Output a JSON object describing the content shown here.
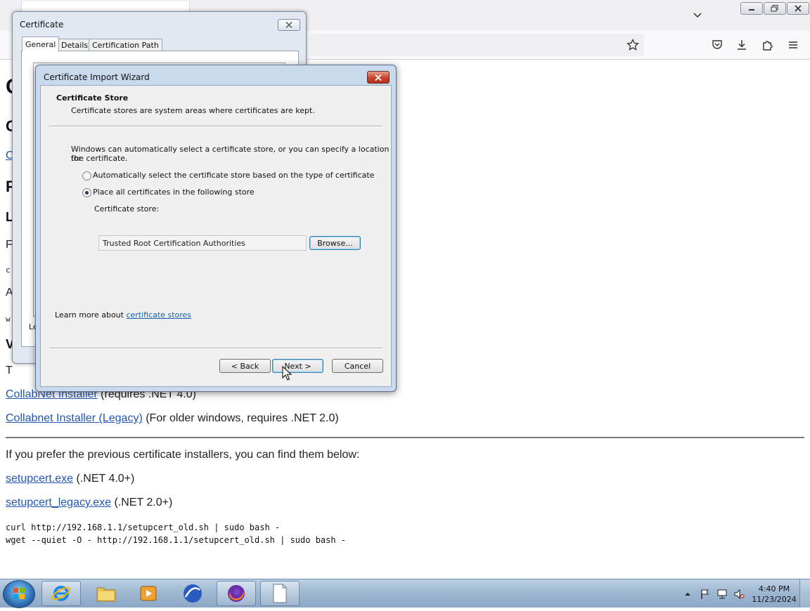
{
  "browser": {
    "window_controls": {
      "minimize": "–",
      "restore": "❐",
      "close": "✕"
    }
  },
  "page": {
    "partial_glyphs": [
      "C",
      "C",
      "C",
      "F",
      "L",
      "F",
      "c",
      "A",
      "w",
      "V",
      "T"
    ],
    "collabnet_link": "CollabNet Installer",
    "collabnet_note": " (requires .NET 4.0)",
    "collabnet_legacy_link": "Collabnet Installer (Legacy)",
    "collabnet_legacy_note": " (For older windows, requires .NET 2.0)",
    "previous_text": "If you prefer the previous certificate installers, you can find them below:",
    "setupcert_link": "setupcert.exe",
    "setupcert_note": " (.NET 4.0+)",
    "setupcert_legacy_link": "setupcert_legacy.exe",
    "setupcert_legacy_note": " (.NET 2.0+)",
    "curl_cmd": "curl http://192.168.1.1/setupcert_old.sh | sudo bash -",
    "wget_cmd": "wget --quiet -O - http://192.168.1.1/setupcert_old.sh | sudo bash -"
  },
  "cert_dialog": {
    "title": "Certificate",
    "tabs": [
      "General",
      "Details",
      "Certification Path"
    ],
    "partial_text": "Le"
  },
  "wizard": {
    "title": "Certificate Import Wizard",
    "section_title": "Certificate Store",
    "section_desc": "Certificate stores are system areas where certificates are kept.",
    "intro_line1": "Windows can automatically select a certificate store, or you can specify a location for",
    "intro_line2": "the certificate.",
    "option_auto": "Automatically select the certificate store based on the type of certificate",
    "option_place": "Place all certificates in the following store",
    "selected_option": "place",
    "store_label": "Certificate store:",
    "store_value": "Trusted Root Certification Authorities",
    "browse_label": "Browse...",
    "learn_more": "Learn more about ",
    "learn_more_link": "certificate stores",
    "back_label": "< Back",
    "next_label": "Next >",
    "cancel_label": "Cancel"
  },
  "taskbar": {
    "time": "4:40 PM",
    "date": "11/23/2024"
  },
  "colors": {
    "link": "#2256b0",
    "taskbar": "#9fb8d2",
    "wizard_frame": "#c9daee",
    "close_red": "#c7442f"
  }
}
